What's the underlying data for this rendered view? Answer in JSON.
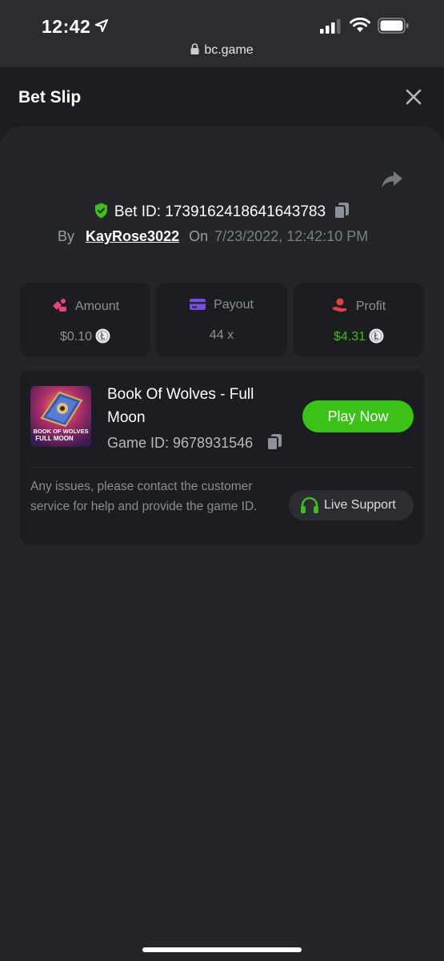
{
  "status_bar": {
    "time": "12:42",
    "url": "bc.game"
  },
  "header": {
    "title": "Bet Slip"
  },
  "bet": {
    "id_label": "Bet ID: 1739162418641643783",
    "by_label": "By",
    "username": "KayRose3022",
    "on_label": "On",
    "datetime": "7/23/2022, 12:42:10 PM"
  },
  "stats": {
    "amount": {
      "label": "Amount",
      "value": "$0.10",
      "accent": "#e8437a"
    },
    "payout": {
      "label": "Payout",
      "value": "44 x",
      "accent": "#7d4ce8"
    },
    "profit": {
      "label": "Profit",
      "value": "$4.31",
      "accent": "#e04040"
    }
  },
  "game": {
    "title": "Book Of Wolves - Full Moon",
    "id_label": "Game ID: 9678931546",
    "thumb_text_1": "BOOK OF WOLVES",
    "thumb_text_2": "FULL MOON",
    "play_label": "Play Now",
    "issue_text": "Any issues, please contact the customer service for help and provide the game ID.",
    "support_label": "Live Support"
  },
  "colors": {
    "background": "#1b1d21",
    "panel": "#23252a",
    "green": "#3bc117"
  },
  "icons": [
    "location-arrow-icon",
    "signal-icon",
    "wifi-icon",
    "battery-icon",
    "lock-icon",
    "close-icon",
    "share-icon",
    "shield-check-icon",
    "copy-icon",
    "coin-icon",
    "headset-icon"
  ]
}
